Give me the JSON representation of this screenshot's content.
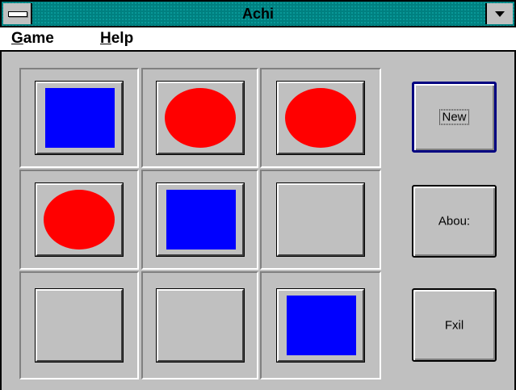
{
  "window": {
    "title": "Achi"
  },
  "menu": {
    "items": [
      {
        "label": "Game",
        "accel": "G",
        "rest": "ame"
      },
      {
        "label": "Help",
        "accel": "H",
        "rest": "elp"
      }
    ]
  },
  "board": {
    "cells": [
      {
        "piece": "square"
      },
      {
        "piece": "circle"
      },
      {
        "piece": "circle"
      },
      {
        "piece": "circle"
      },
      {
        "piece": "square"
      },
      {
        "piece": "empty"
      },
      {
        "piece": "empty"
      },
      {
        "piece": "empty"
      },
      {
        "piece": "square"
      }
    ],
    "colors": {
      "square": "#0000ff",
      "circle": "#ff0000",
      "face": "#c0c0c0"
    }
  },
  "buttons": {
    "new_label": "New",
    "about_label": "Abou:",
    "exit_label": "Fxil"
  },
  "colors": {
    "titlebar": "#008080",
    "default_button_border": "#000080"
  }
}
